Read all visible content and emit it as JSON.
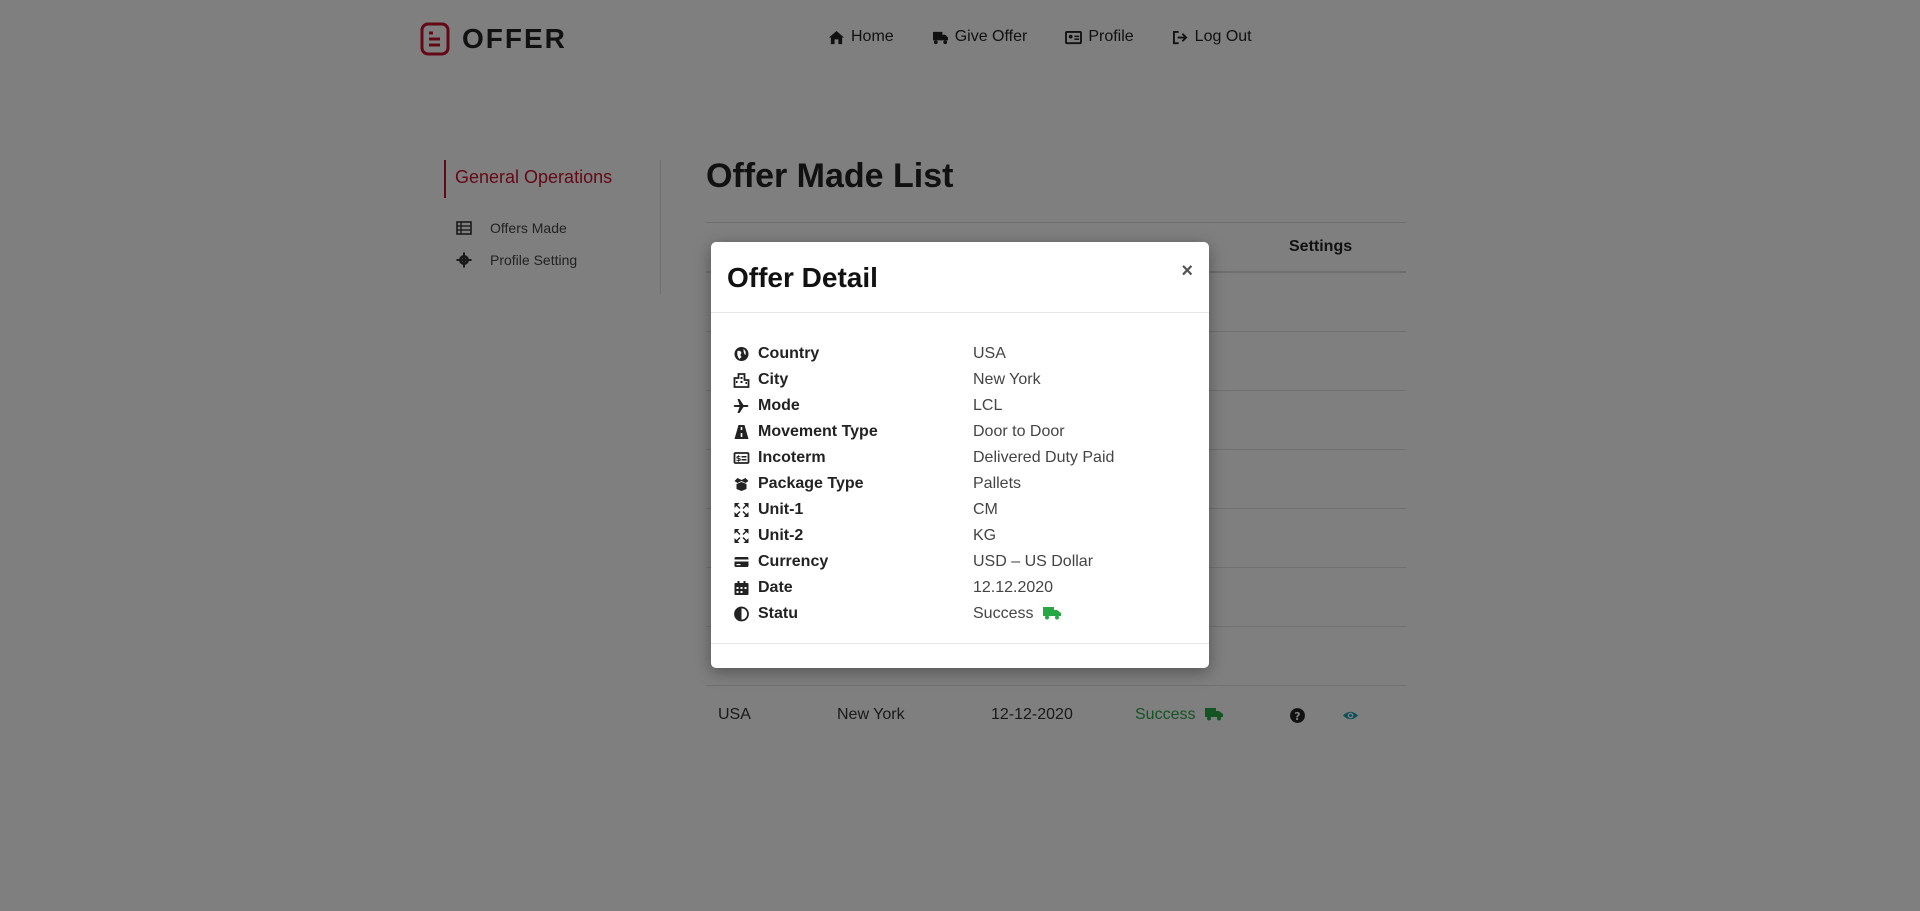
{
  "app": {
    "logo_text": "OFFER",
    "brand_color": "#c8102e"
  },
  "nav": {
    "items": [
      {
        "label": "Home",
        "icon": "home-icon"
      },
      {
        "label": "Give Offer",
        "icon": "truck-icon"
      },
      {
        "label": "Profile",
        "icon": "id-card-icon"
      },
      {
        "label": "Log Out",
        "icon": "sign-out-icon"
      }
    ]
  },
  "sidebar": {
    "title": "General Operations",
    "items": [
      {
        "label": "Offers Made",
        "icon": "list-icon"
      },
      {
        "label": "Profile Setting",
        "icon": "gear-icon"
      }
    ]
  },
  "main": {
    "title": "Offer Made List",
    "settings_header": "Settings",
    "rows": [
      {
        "country": "USA",
        "city": "New York",
        "date": "12-12-2020",
        "status": "Success"
      }
    ]
  },
  "modal": {
    "title": "Offer Detail",
    "close": "×",
    "details": [
      {
        "label": "Country",
        "value": "USA",
        "icon": "globe-icon"
      },
      {
        "label": "City",
        "value": "New York",
        "icon": "city-icon"
      },
      {
        "label": "Mode",
        "value": "LCL",
        "icon": "plane-icon"
      },
      {
        "label": "Movement Type",
        "value": "Door to Door",
        "icon": "road-icon"
      },
      {
        "label": "Incoterm",
        "value": "Delivered Duty Paid",
        "icon": "money-check-icon"
      },
      {
        "label": "Package Type",
        "value": "Pallets",
        "icon": "box-open-icon"
      },
      {
        "label": "Unit-1",
        "value": "CM",
        "icon": "expand-icon"
      },
      {
        "label": "Unit-2",
        "value": "KG",
        "icon": "expand-icon"
      },
      {
        "label": "Currency",
        "value": "USD – US Dollar",
        "icon": "credit-card-icon"
      },
      {
        "label": "Date",
        "value": "12.12.2020",
        "icon": "calendar-icon"
      },
      {
        "label": "Statu",
        "value": "Success",
        "icon": "adjust-icon"
      }
    ]
  },
  "colors": {
    "success": "#28a745",
    "warning": "#d99a00",
    "danger": "#dc3545",
    "info": "#17a2b8"
  }
}
